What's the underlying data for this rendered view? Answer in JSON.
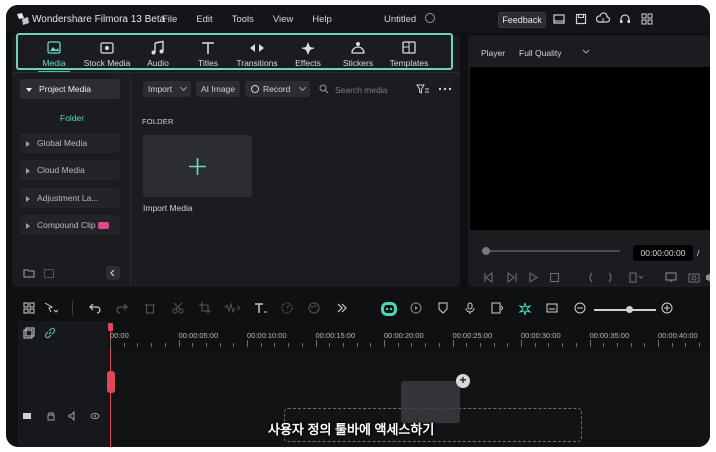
{
  "app": {
    "title": "Wondershare Filmora 13 Beta",
    "menu": [
      "File",
      "Edit",
      "Tools",
      "View",
      "Help"
    ],
    "document_title": "Untitled",
    "feedback_label": "Feedback",
    "accent_color": "#37c6b2",
    "highlight_color": "#6ed3b7"
  },
  "toolbar": {
    "items": [
      {
        "label": "Media",
        "icon": "media-icon",
        "active": true
      },
      {
        "label": "Stock Media",
        "icon": "stock-media-icon"
      },
      {
        "label": "Audio",
        "icon": "music-note-icon"
      },
      {
        "label": "Titles",
        "icon": "text-t-icon"
      },
      {
        "label": "Transitions",
        "icon": "transitions-icon"
      },
      {
        "label": "Effects",
        "icon": "effects-sparkle-icon"
      },
      {
        "label": "Stickers",
        "icon": "stickers-icon"
      },
      {
        "label": "Templates",
        "icon": "templates-icon"
      }
    ]
  },
  "sidebar": {
    "project_media": "Project Media",
    "folder": "Folder",
    "items": [
      "Global Media",
      "Cloud Media",
      "Adjustment La...",
      "Compound Clip"
    ]
  },
  "media": {
    "import_label": "Import",
    "ai_image_label": "AI Image",
    "record_label": "Record",
    "search_placeholder": "Search media",
    "folder_heading": "FOLDER",
    "import_media_label": "Import Media"
  },
  "player": {
    "label": "Player",
    "quality": "Full Quality",
    "timecode": "00:00:00:00",
    "timecode_separator": "/"
  },
  "timeline": {
    "ticks": [
      "00:00",
      "00:00:05:00",
      "00:00:10:00",
      "00:00:15:00",
      "00:00:20:00",
      "00:00:25:00",
      "00:00:30:00",
      "00:00:35:00",
      "00:00:40:00"
    ],
    "zoom_level": 0.5
  },
  "caption": "사용자 정의 툴바에 액세스하기"
}
